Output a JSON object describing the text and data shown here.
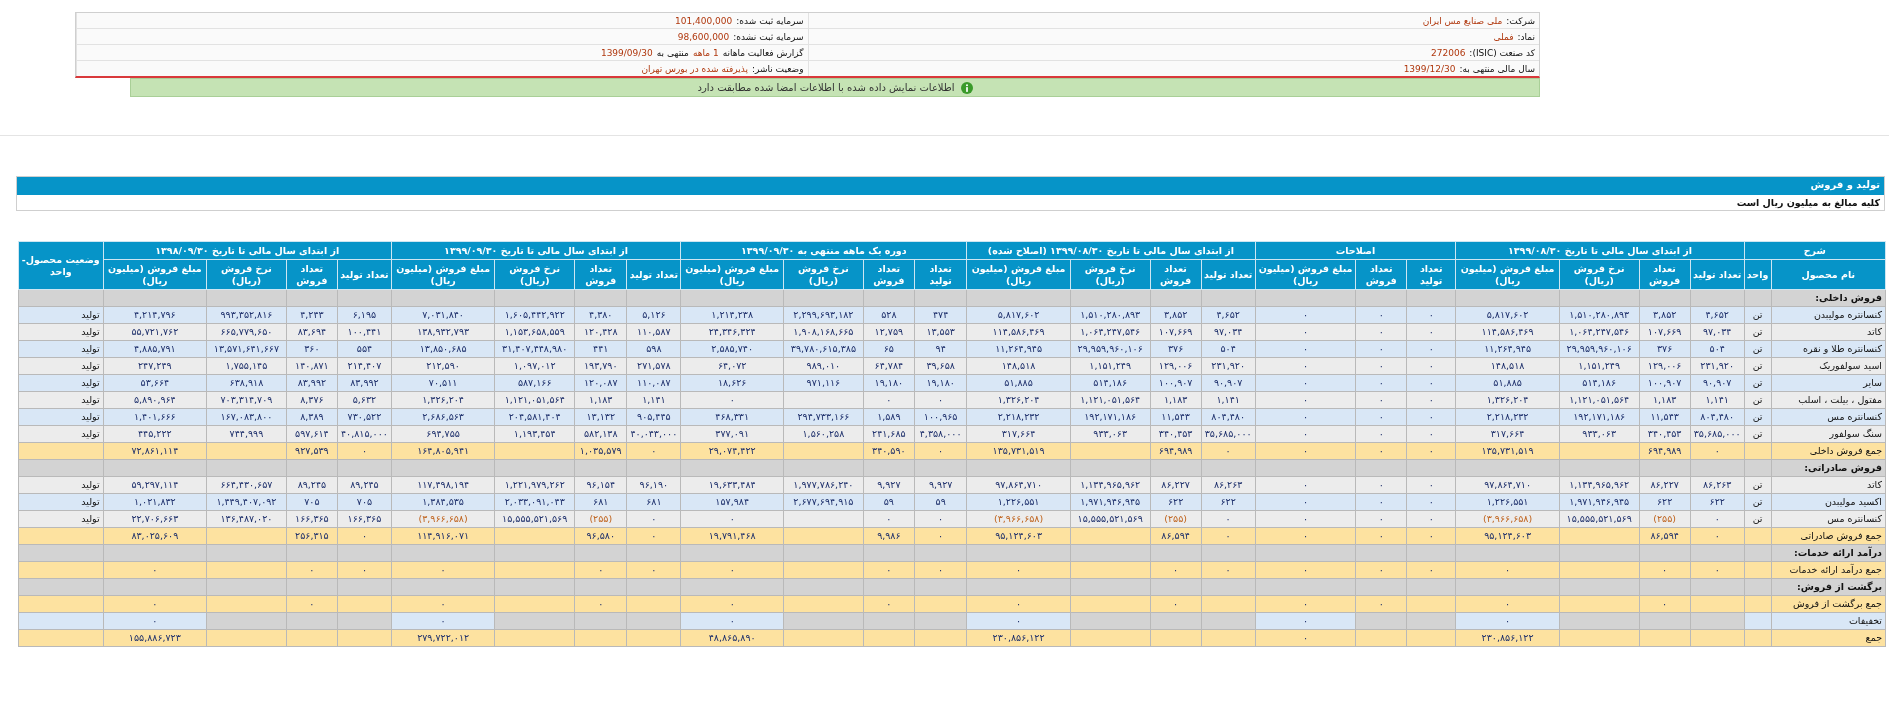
{
  "company_info": {
    "rows": [
      {
        "right": {
          "label": "شرکت:",
          "value": "ملی صنایع مس ایران"
        },
        "left": {
          "label": "سرمایه ثبت شده:",
          "value": "101,400,000"
        }
      },
      {
        "right": {
          "label": "نماد:",
          "value": "فملی"
        },
        "left": {
          "label": "سرمایه ثبت نشده:",
          "value": "98,600,000"
        }
      },
      {
        "right": {
          "label": "کد صنعت (ISIC):",
          "value": "272006"
        },
        "left": {
          "label": "گزارش فعالیت ماهانه",
          "value": "1 ماهه",
          "suffix": "منتهی به",
          "date": "1399/09/30"
        }
      },
      {
        "right": {
          "label": "سال مالی منتهی به:",
          "value": "1399/12/30"
        },
        "left": {
          "label": "وضعیت ناشر:",
          "value": "پذیرفته شده در بورس تهران"
        }
      }
    ]
  },
  "notice": {
    "text": "اطلاعات نمایش داده شده با اطلاعات امضا شده مطابقت دارد"
  },
  "section": {
    "title": "تولید و فروش",
    "subtitle": "کلیه مبالغ به میلیون ریال است"
  },
  "table": {
    "groups": [
      {
        "label": "شرح",
        "columns": [
          {
            "label": "نام محصول",
            "kind": "name"
          },
          {
            "label": "واحد",
            "kind": "unit"
          }
        ]
      },
      {
        "label": "از ابتدای سال مالی تا تاریخ ۱۳۹۹/۰۸/۳۰",
        "columns": [
          {
            "label": "تعداد تولید",
            "kind": "count"
          },
          {
            "label": "تعداد فروش",
            "kind": "count"
          },
          {
            "label": "نرخ فروش (ریال)",
            "kind": "rate"
          },
          {
            "label": "مبلغ فروش (میلیون ریال)",
            "kind": "amount"
          }
        ]
      },
      {
        "label": "اصلاحات",
        "columns": [
          {
            "label": "تعداد تولید",
            "kind": "count"
          },
          {
            "label": "تعداد فروش",
            "kind": "count"
          },
          {
            "label": "مبلغ فروش (میلیون ریال)",
            "kind": "amount"
          }
        ]
      },
      {
        "label": "از ابتدای سال مالی تا تاریخ ۱۳۹۹/۰۸/۳۰ (اصلاح شده)",
        "columns": [
          {
            "label": "تعداد تولید",
            "kind": "count"
          },
          {
            "label": "تعداد فروش",
            "kind": "count"
          },
          {
            "label": "نرخ فروش (ریال)",
            "kind": "rate"
          },
          {
            "label": "مبلغ فروش (میلیون ریال)",
            "kind": "amount"
          }
        ]
      },
      {
        "label": "دوره یک ماهه منتهی به ۱۳۹۹/۰۹/۳۰",
        "columns": [
          {
            "label": "تعداد تولید",
            "kind": "count"
          },
          {
            "label": "تعداد فروش",
            "kind": "count"
          },
          {
            "label": "نرخ فروش (ریال)",
            "kind": "rate"
          },
          {
            "label": "مبلغ فروش (میلیون ریال)",
            "kind": "amount"
          }
        ]
      },
      {
        "label": "از ابتدای سال مالی تا تاریخ ۱۳۹۹/۰۹/۳۰",
        "columns": [
          {
            "label": "تعداد تولید",
            "kind": "count"
          },
          {
            "label": "تعداد فروش",
            "kind": "count"
          },
          {
            "label": "نرخ فروش (ریال)",
            "kind": "rate"
          },
          {
            "label": "مبلغ فروش (میلیون ریال)",
            "kind": "amount"
          }
        ]
      },
      {
        "label": "از ابتدای سال مالی تا تاریخ ۱۳۹۸/۰۹/۳۰",
        "columns": [
          {
            "label": "تعداد تولید",
            "kind": "count"
          },
          {
            "label": "تعداد فروش",
            "kind": "count"
          },
          {
            "label": "نرخ فروش (ریال)",
            "kind": "rate"
          },
          {
            "label": "مبلغ فروش (میلیون ریال)",
            "kind": "amount"
          }
        ]
      },
      {
        "label": "وضعیت محصول-واحد"
      }
    ],
    "rows": [
      {
        "kind": "section",
        "name": "فروش داخلی:"
      },
      {
        "kind": "item",
        "name": "کنسانتره مولیبدن",
        "unit": "تن",
        "status": "تولید",
        "cells": [
          "۴,۶۵۲",
          "۳,۸۵۲",
          "۱,۵۱۰,۲۸۰,۸۹۳",
          "۵,۸۱۷,۶۰۲",
          "۰",
          "۰",
          "۰",
          "۴,۶۵۲",
          "۳,۸۵۲",
          "۱,۵۱۰,۲۸۰,۸۹۳",
          "۵,۸۱۷,۶۰۲",
          "۴۷۴",
          "۵۲۸",
          "۲,۲۹۹,۶۹۳,۱۸۲",
          "۱,۲۱۴,۲۳۸",
          "۵,۱۲۶",
          "۴,۳۸۰",
          "۱,۶۰۵,۴۴۲,۹۲۲",
          "۷,۰۳۱,۸۴۰",
          "۶,۱۹۵",
          "۴,۲۴۳",
          "۹۹۳,۳۵۲,۸۱۶",
          "۴,۲۱۴,۷۹۶"
        ]
      },
      {
        "kind": "item-alt",
        "name": "کاتد",
        "unit": "تن",
        "status": "تولید",
        "cells": [
          "۹۷,۰۳۴",
          "۱۰۷,۶۶۹",
          "۱,۰۶۴,۲۴۷,۵۴۶",
          "۱۱۴,۵۸۶,۴۶۹",
          "۰",
          "۰",
          "۰",
          "۹۷,۰۳۴",
          "۱۰۷,۶۶۹",
          "۱,۰۶۴,۲۴۷,۵۴۶",
          "۱۱۴,۵۸۶,۴۶۹",
          "۱۳,۵۵۳",
          "۱۲,۷۵۹",
          "۱,۹۰۸,۱۶۸,۶۶۵",
          "۲۴,۳۴۶,۳۲۴",
          "۱۱۰,۵۸۷",
          "۱۲۰,۴۲۸",
          "۱,۱۵۳,۶۵۸,۵۵۹",
          "۱۳۸,۹۳۲,۷۹۳",
          "۱۰۰,۴۴۱",
          "۸۳,۶۹۴",
          "۶۶۵,۷۷۹,۶۵۰",
          "۵۵,۷۲۱,۷۶۲"
        ]
      },
      {
        "kind": "item",
        "name": "کنسانتره طلا و نقره",
        "unit": "تن",
        "status": "تولید",
        "cells": [
          "۵۰۴",
          "۳۷۶",
          "۲۹,۹۵۹,۹۶۰,۱۰۶",
          "۱۱,۲۶۴,۹۴۵",
          "۰",
          "۰",
          "۰",
          "۵۰۴",
          "۳۷۶",
          "۲۹,۹۵۹,۹۶۰,۱۰۶",
          "۱۱,۲۶۴,۹۴۵",
          "۹۴",
          "۶۵",
          "۳۹,۷۸۰,۶۱۵,۳۸۵",
          "۲,۵۸۵,۷۴۰",
          "۵۹۸",
          "۴۴۱",
          "۳۱,۴۰۷,۴۴۸,۹۸۰",
          "۱۳,۸۵۰,۶۸۵",
          "۵۵۴",
          "۳۶۰",
          "۱۳,۵۷۱,۶۴۱,۶۶۷",
          "۴,۸۸۵,۷۹۱"
        ]
      },
      {
        "kind": "item-alt",
        "name": "اسید سولفوریک",
        "unit": "تن",
        "status": "تولید",
        "cells": [
          "۲۳۱,۹۲۰",
          "۱۲۹,۰۰۶",
          "۱,۱۵۱,۲۴۹",
          "۱۴۸,۵۱۸",
          "۰",
          "۰",
          "۰",
          "۲۳۱,۹۲۰",
          "۱۲۹,۰۰۶",
          "۱,۱۵۱,۲۴۹",
          "۱۴۸,۵۱۸",
          "۳۹,۶۵۸",
          "۶۴,۷۸۴",
          "۹۸۹,۰۱۰",
          "۶۴,۰۷۲",
          "۲۷۱,۵۷۸",
          "۱۹۳,۷۹۰",
          "۱,۰۹۷,۰۱۲",
          "۲۱۲,۵۹۰",
          "۲۱۴,۴۰۷",
          "۱۴۰,۸۷۱",
          "۱,۷۵۵,۱۴۵",
          "۲۴۷,۲۴۹"
        ]
      },
      {
        "kind": "item",
        "name": "سایر",
        "unit": "تن",
        "status": "تولید",
        "cells": [
          "۹۰,۹۰۷",
          "۱۰۰,۹۰۷",
          "۵۱۴,۱۸۶",
          "۵۱,۸۸۵",
          "۰",
          "۰",
          "۰",
          "۹۰,۹۰۷",
          "۱۰۰,۹۰۷",
          "۵۱۴,۱۸۶",
          "۵۱,۸۸۵",
          "۱۹,۱۸۰",
          "۱۹,۱۸۰",
          "۹۷۱,۱۱۶",
          "۱۸,۶۲۶",
          "۱۱۰,۰۸۷",
          "۱۲۰,۰۸۷",
          "۵۸۷,۱۶۶",
          "۷۰,۵۱۱",
          "۸۳,۹۹۲",
          "۸۳,۹۹۲",
          "۶۳۸,۹۱۸",
          "۵۳,۶۶۴"
        ]
      },
      {
        "kind": "item-alt",
        "name": "مفتول ، بیلت ، اسلب",
        "unit": "تن",
        "status": "تولید",
        "cells": [
          "۱,۱۴۱",
          "۱,۱۸۳",
          "۱,۱۲۱,۰۵۱,۵۶۴",
          "۱,۳۲۶,۲۰۴",
          "۰",
          "۰",
          "۰",
          "۱,۱۴۱",
          "۱,۱۸۳",
          "۱,۱۲۱,۰۵۱,۵۶۴",
          "۱,۳۲۶,۲۰۴",
          "۰",
          "۰",
          null,
          "۰",
          "۱,۱۴۱",
          "۱,۱۸۳",
          "۱,۱۲۱,۰۵۱,۵۶۴",
          "۱,۳۲۶,۲۰۴",
          "۵,۶۳۲",
          "۸,۳۷۶",
          "۷۰۳,۳۱۴,۷۰۹",
          "۵,۸۹۰,۹۶۴"
        ]
      },
      {
        "kind": "item",
        "name": "کنسانتره مس",
        "unit": "تن",
        "status": "تولید",
        "cells": [
          "۸۰۴,۴۸۰",
          "۱۱,۵۴۳",
          "۱۹۲,۱۷۱,۱۸۶",
          "۲,۲۱۸,۲۳۲",
          "۰",
          "۰",
          "۰",
          "۸۰۴,۴۸۰",
          "۱۱,۵۴۳",
          "۱۹۲,۱۷۱,۱۸۶",
          "۲,۲۱۸,۲۳۲",
          "۱۰۰,۹۶۵",
          "۱,۵۸۹",
          "۲۹۴,۷۳۳,۱۶۶",
          "۴۶۸,۳۳۱",
          "۹۰۵,۴۴۵",
          "۱۳,۱۳۲",
          "۲۰۴,۵۸۱,۴۰۴",
          "۲,۶۸۶,۵۶۳",
          "۷۳۰,۵۲۲",
          "۸,۳۸۹",
          "۱۶۷,۰۸۳,۸۰۰",
          "۱,۴۰۱,۶۶۶"
        ]
      },
      {
        "kind": "item-alt",
        "name": "سنگ سولفور",
        "unit": "تن",
        "status": "تولید",
        "cells": [
          "۳۵,۶۸۵,۰۰۰",
          "۳۴۰,۴۵۳",
          "۹۳۳,۰۶۳",
          "۳۱۷,۶۶۴",
          "۰",
          "۰",
          "۰",
          "۳۵,۶۸۵,۰۰۰",
          "۳۴۰,۴۵۳",
          "۹۳۳,۰۶۳",
          "۳۱۷,۶۶۴",
          "۴,۳۵۸,۰۰۰",
          "۲۴۱,۶۸۵",
          "۱,۵۶۰,۲۵۸",
          "۳۷۷,۰۹۱",
          "۴۰,۰۴۳,۰۰۰",
          "۵۸۲,۱۳۸",
          "۱,۱۹۳,۴۵۴",
          "۶۹۴,۷۵۵",
          "۴۰,۸۱۵,۰۰۰",
          "۵۹۷,۶۱۴",
          "۷۴۴,۹۹۹",
          "۴۴۵,۲۲۲"
        ]
      },
      {
        "kind": "total",
        "name": "جمع فروش داخلی",
        "cells": [
          "۰",
          "۶۹۴,۹۸۹",
          null,
          "۱۳۵,۷۳۱,۵۱۹",
          "۰",
          "۰",
          "۰",
          "۰",
          "۶۹۴,۹۸۹",
          null,
          "۱۳۵,۷۳۱,۵۱۹",
          "۰",
          "۳۴۰,۵۹۰",
          null,
          "۲۹,۰۷۴,۴۲۲",
          "۰",
          "۱,۰۳۵,۵۷۹",
          null,
          "۱۶۴,۸۰۵,۹۴۱",
          "۰",
          "۹۲۷,۵۳۹",
          null,
          "۷۲,۸۶۱,۱۱۴"
        ]
      },
      {
        "kind": "section",
        "name": "فروش صادراتی:"
      },
      {
        "kind": "item-alt",
        "name": "کاتد",
        "unit": "تن",
        "status": "تولید",
        "cells": [
          "۸۶,۲۶۳",
          "۸۶,۲۲۷",
          "۱,۱۳۴,۹۶۵,۹۶۲",
          "۹۷,۸۶۴,۷۱۰",
          "۰",
          "۰",
          "۰",
          "۸۶,۲۶۳",
          "۸۶,۲۲۷",
          "۱,۱۳۴,۹۶۵,۹۶۲",
          "۹۷,۸۶۴,۷۱۰",
          "۹,۹۲۷",
          "۹,۹۲۷",
          "۱,۹۷۷,۷۸۶,۲۴۰",
          "۱۹,۶۳۳,۴۸۴",
          "۹۶,۱۹۰",
          "۹۶,۱۵۴",
          "۱,۲۲۱,۹۷۹,۲۶۲",
          "۱۱۷,۴۹۸,۱۹۴",
          "۸۹,۲۴۵",
          "۸۹,۲۴۵",
          "۶۶۴,۴۳۰,۶۵۷",
          "۵۹,۲۹۷,۱۱۴"
        ]
      },
      {
        "kind": "item",
        "name": "اکسید مولیبدن",
        "unit": "تن",
        "status": "تولید",
        "cells": [
          "۶۲۲",
          "۶۲۲",
          "۱,۹۷۱,۹۴۶,۹۴۵",
          "۱,۲۲۶,۵۵۱",
          "۰",
          "۰",
          "۰",
          "۶۲۲",
          "۶۲۲",
          "۱,۹۷۱,۹۴۶,۹۴۵",
          "۱,۲۲۶,۵۵۱",
          "۵۹",
          "۵۹",
          "۲,۶۷۷,۶۹۴,۹۱۵",
          "۱۵۷,۹۸۴",
          "۶۸۱",
          "۶۸۱",
          "۲,۰۳۳,۰۹۱,۰۴۳",
          "۱,۳۸۴,۵۳۵",
          "۷۰۵",
          "۷۰۵",
          "۱,۴۴۹,۴۰۷,۰۹۲",
          "۱,۰۲۱,۸۳۲"
        ]
      },
      {
        "kind": "item-alt",
        "name": "کنسانتره مس",
        "unit": "تن",
        "status": "تولید",
        "cells": [
          "۰",
          {
            "value": "(۲۵۵)",
            "negative": true
          },
          "۱۵,۵۵۵,۵۲۱,۵۶۹",
          {
            "value": "(۳,۹۶۶,۶۵۸)",
            "negative": true
          },
          "۰",
          "۰",
          "۰",
          "۰",
          {
            "value": "(۲۵۵)",
            "negative": true
          },
          "۱۵,۵۵۵,۵۲۱,۵۶۹",
          {
            "value": "(۳,۹۶۶,۶۵۸)",
            "negative": true
          },
          "۰",
          "۰",
          null,
          "۰",
          "۰",
          {
            "value": "(۲۵۵)",
            "negative": true
          },
          "۱۵,۵۵۵,۵۲۱,۵۶۹",
          {
            "value": "(۳,۹۶۶,۶۵۸)",
            "negative": true
          },
          "۱۶۶,۳۶۵",
          "۱۶۶,۳۶۵",
          "۱۳۶,۴۸۷,۰۲۰",
          "۲۲,۷۰۶,۶۶۳"
        ]
      },
      {
        "kind": "total",
        "name": "جمع فروش صادراتی",
        "cells": [
          "۰",
          "۸۶,۵۹۴",
          null,
          "۹۵,۱۲۴,۶۰۳",
          "۰",
          "۰",
          "۰",
          "۰",
          "۸۶,۵۹۴",
          null,
          "۹۵,۱۲۴,۶۰۳",
          "۰",
          "۹,۹۸۶",
          null,
          "۱۹,۷۹۱,۴۶۸",
          "۰",
          "۹۶,۵۸۰",
          null,
          "۱۱۴,۹۱۶,۰۷۱",
          "۰",
          "۲۵۶,۳۱۵",
          null,
          "۸۳,۰۲۵,۶۰۹"
        ]
      },
      {
        "kind": "section",
        "name": "درآمد ارائه خدمات:"
      },
      {
        "kind": "total",
        "name": "جمع درآمد ارائه خدمات",
        "cells": [
          "۰",
          "۰",
          null,
          "۰",
          "۰",
          "۰",
          "۰",
          "۰",
          "۰",
          null,
          "۰",
          "۰",
          "۰",
          null,
          "۰",
          "۰",
          "۰",
          null,
          "۰",
          "۰",
          "۰",
          null,
          "۰"
        ]
      },
      {
        "kind": "section",
        "name": "برگشت از فروش:"
      },
      {
        "kind": "total",
        "name": "جمع برگشت از فروش",
        "cells": [
          null,
          "۰",
          null,
          "۰",
          null,
          "۰",
          "۰",
          null,
          "۰",
          null,
          "۰",
          null,
          "۰",
          null,
          "۰",
          null,
          "۰",
          null,
          "۰",
          null,
          "۰",
          null,
          "۰"
        ]
      },
      {
        "kind": "discount",
        "name": "تخفیفات",
        "cells": [
          null,
          null,
          null,
          "۰",
          null,
          null,
          "۰",
          null,
          null,
          null,
          "۰",
          null,
          null,
          null,
          "۰",
          null,
          null,
          null,
          "۰",
          null,
          null,
          null,
          "۰"
        ]
      },
      {
        "kind": "total",
        "name": "جمع",
        "cells": [
          null,
          null,
          null,
          "۲۳۰,۸۵۶,۱۲۲",
          null,
          null,
          "۰",
          null,
          null,
          null,
          "۲۳۰,۸۵۶,۱۲۲",
          null,
          null,
          null,
          "۴۸,۸۶۵,۸۹۰",
          null,
          null,
          null,
          "۲۷۹,۷۲۲,۰۱۲",
          null,
          null,
          null,
          "۱۵۵,۸۸۶,۷۲۳"
        ]
      }
    ]
  }
}
